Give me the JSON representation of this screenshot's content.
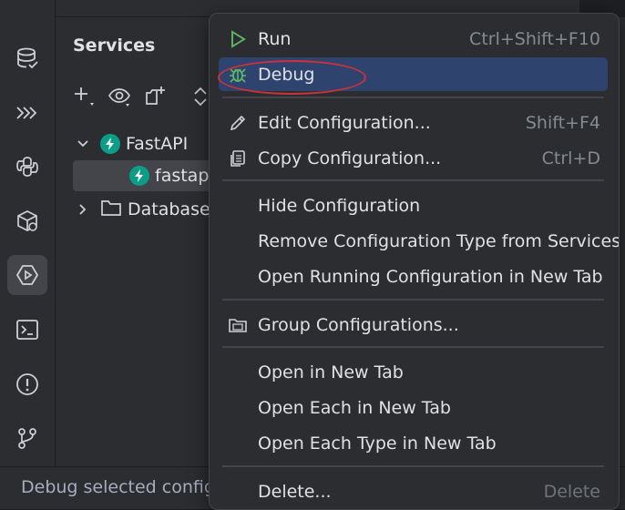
{
  "toolstrip": {
    "items": [
      {
        "icon": "database-icon"
      },
      {
        "icon": "endpoints-icon"
      },
      {
        "icon": "python-console-icon"
      },
      {
        "icon": "python-packages-icon"
      },
      {
        "icon": "services-icon",
        "active": true
      },
      {
        "icon": "terminal-icon"
      },
      {
        "icon": "problems-icon"
      },
      {
        "icon": "git-icon"
      }
    ]
  },
  "services": {
    "title": "Services",
    "toolbar": [
      "add-icon",
      "view-options-icon",
      "new-group-icon",
      "expand-collapse-icon"
    ],
    "tree": {
      "fastapi_group": "FastAPI",
      "fastapi_config": "fastapi_",
      "database": "Database"
    }
  },
  "status": {
    "text": "Debug selected configu"
  },
  "context_menu": {
    "run": {
      "label": "Run",
      "shortcut": "Ctrl+Shift+F10"
    },
    "debug": {
      "label": "Debug"
    },
    "edit_configuration": {
      "label": "Edit Configuration...",
      "shortcut": "Shift+F4"
    },
    "copy_configuration": {
      "label": "Copy Configuration...",
      "shortcut": "Ctrl+D"
    },
    "hide_configuration": {
      "label": "Hide Configuration"
    },
    "remove_configuration_type": {
      "label": "Remove Configuration Type from Services"
    },
    "open_running_configuration": {
      "label": "Open Running Configuration in New Tab"
    },
    "group_configurations": {
      "label": "Group Configurations..."
    },
    "open_in_new_tab": {
      "label": "Open in New Tab"
    },
    "open_each_in_new_tab": {
      "label": "Open Each in New Tab"
    },
    "open_each_type_in_new_tab": {
      "label": "Open Each Type in New Tab"
    },
    "delete": {
      "label": "Delete...",
      "shortcut": "Delete"
    }
  },
  "colors": {
    "background": "#2b2d30",
    "menu_highlight": "#2e436e",
    "annotation_circle": "#d0303a",
    "run_green": "#5fb865",
    "fastapi_teal": "#0a9d88"
  }
}
